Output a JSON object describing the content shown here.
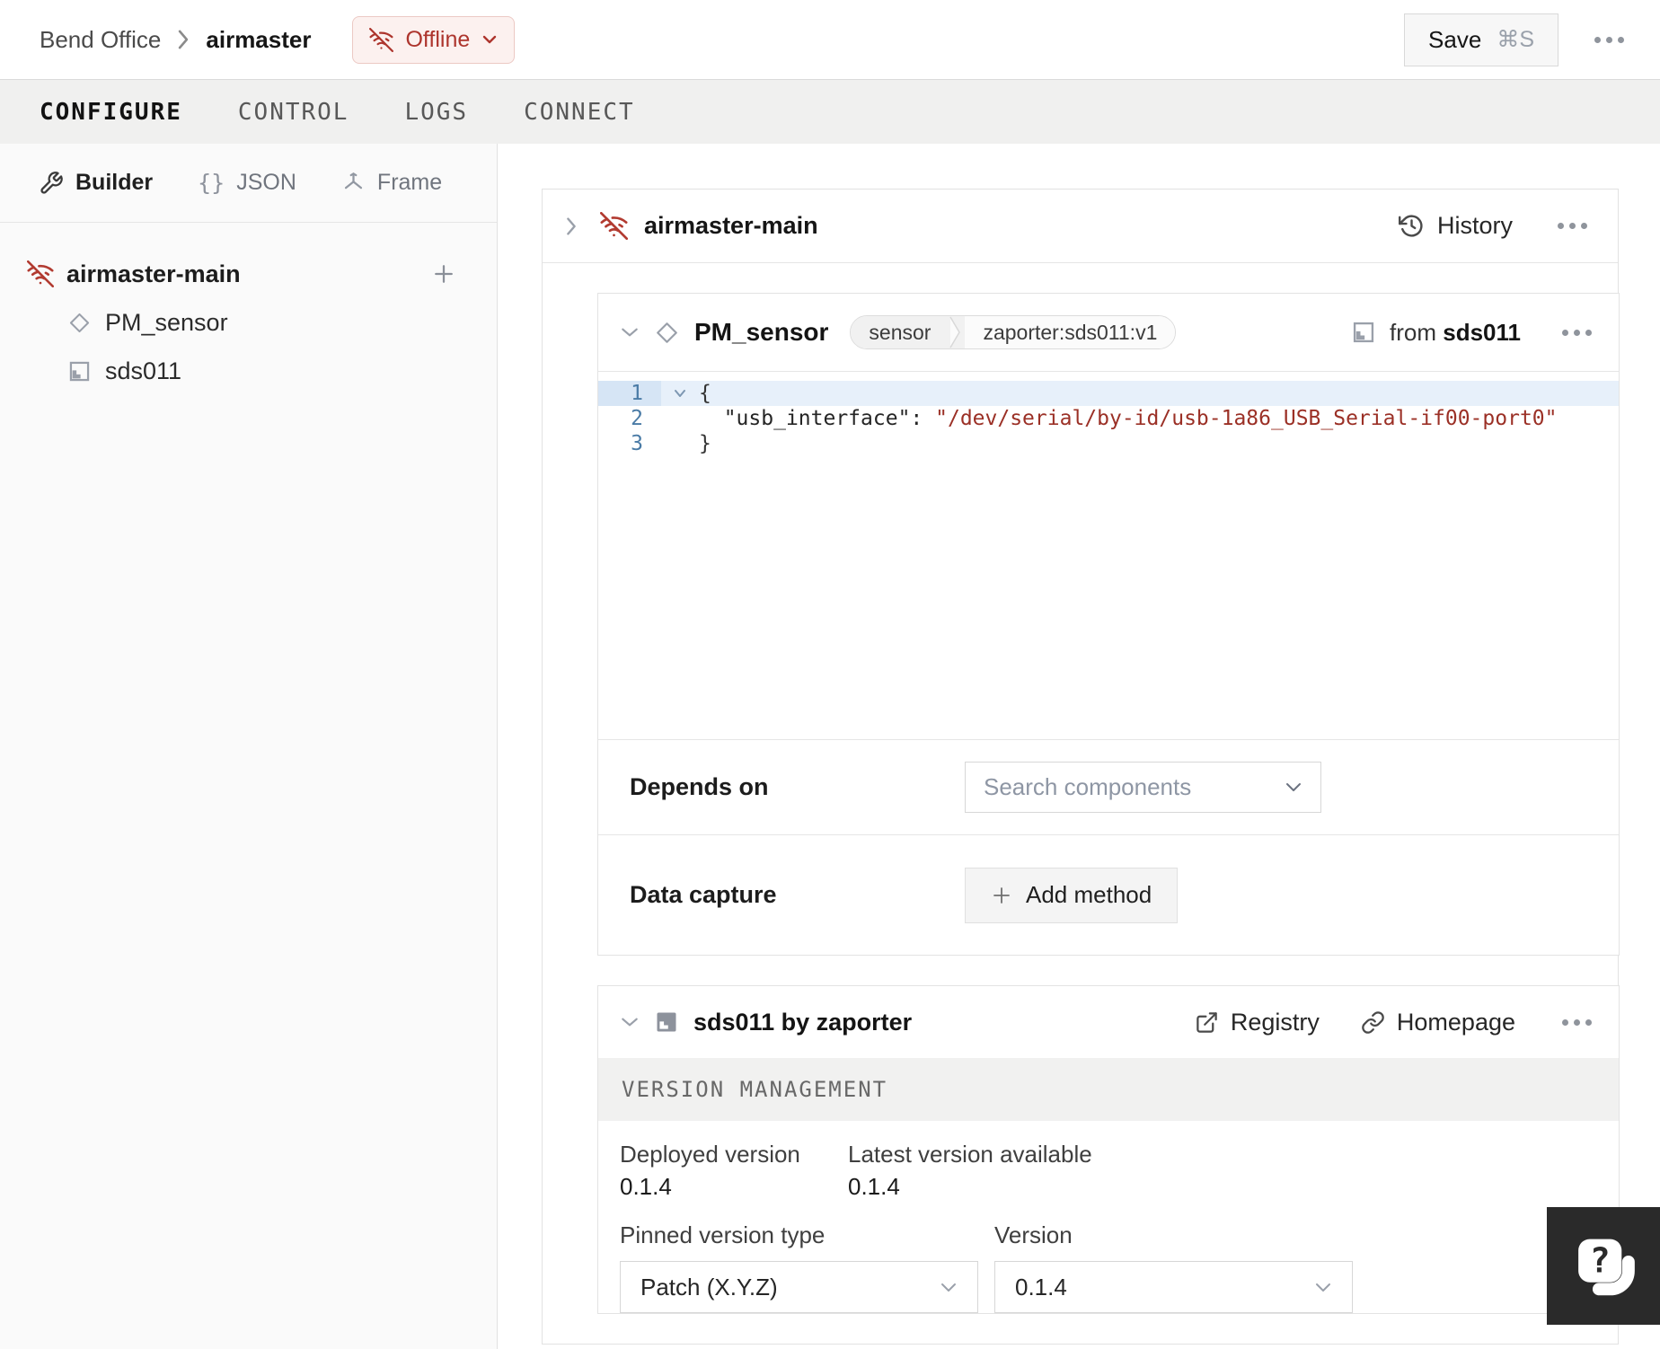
{
  "header": {
    "breadcrumb": {
      "org": "Bend Office",
      "machine": "airmaster"
    },
    "status": {
      "label": "Offline"
    },
    "save": {
      "label": "Save",
      "shortcut": "⌘S"
    }
  },
  "tabs": [
    {
      "label": "CONFIGURE",
      "active": true
    },
    {
      "label": "CONTROL",
      "active": false
    },
    {
      "label": "LOGS",
      "active": false
    },
    {
      "label": "CONNECT",
      "active": false
    }
  ],
  "sidebar": {
    "modes": [
      {
        "label": "Builder",
        "icon": "builder-wrench"
      },
      {
        "label": "JSON",
        "icon": "curly-braces"
      },
      {
        "label": "Frame",
        "icon": "frame-axes"
      }
    ],
    "tree": {
      "part": "airmaster-main",
      "children": [
        {
          "label": "PM_sensor",
          "icon": "component-diamond"
        },
        {
          "label": "sds011",
          "icon": "module"
        }
      ]
    }
  },
  "part_card": {
    "title": "airmaster-main",
    "history": "History"
  },
  "component_card": {
    "title": "PM_sensor",
    "tags": {
      "type": "sensor",
      "model": "zaporter:sds011:v1"
    },
    "from": {
      "prefix": "from",
      "module": "sds011"
    },
    "editor": {
      "lines": [
        {
          "num": "1",
          "code": "{"
        },
        {
          "num": "2",
          "indent": "  ",
          "key": "\"usb_interface\"",
          "sep": ": ",
          "value": "\"/dev/serial/by-id/usb-1a86_USB_Serial-if00-port0\""
        },
        {
          "num": "3",
          "code": "}"
        }
      ]
    },
    "depends_on": {
      "label": "Depends on",
      "placeholder": "Search components"
    },
    "data_capture": {
      "label": "Data capture",
      "add_button": "Add method"
    }
  },
  "module_card": {
    "title": "sds011 by zaporter",
    "registry": "Registry",
    "homepage": "Homepage",
    "section": "VERSION MANAGEMENT",
    "deployed_version": {
      "label": "Deployed version",
      "value": "0.1.4"
    },
    "latest_version": {
      "label": "Latest version available",
      "value": "0.1.4"
    },
    "pinned_type": {
      "label": "Pinned version type",
      "value": "Patch (X.Y.Z)"
    },
    "version": {
      "label": "Version",
      "value": "0.1.4"
    }
  },
  "colors": {
    "offline_red": "#ad352d",
    "offline_bg": "#fcf1ef",
    "code_string": "#9b3026",
    "line_highlight": "#e7f0fa"
  }
}
